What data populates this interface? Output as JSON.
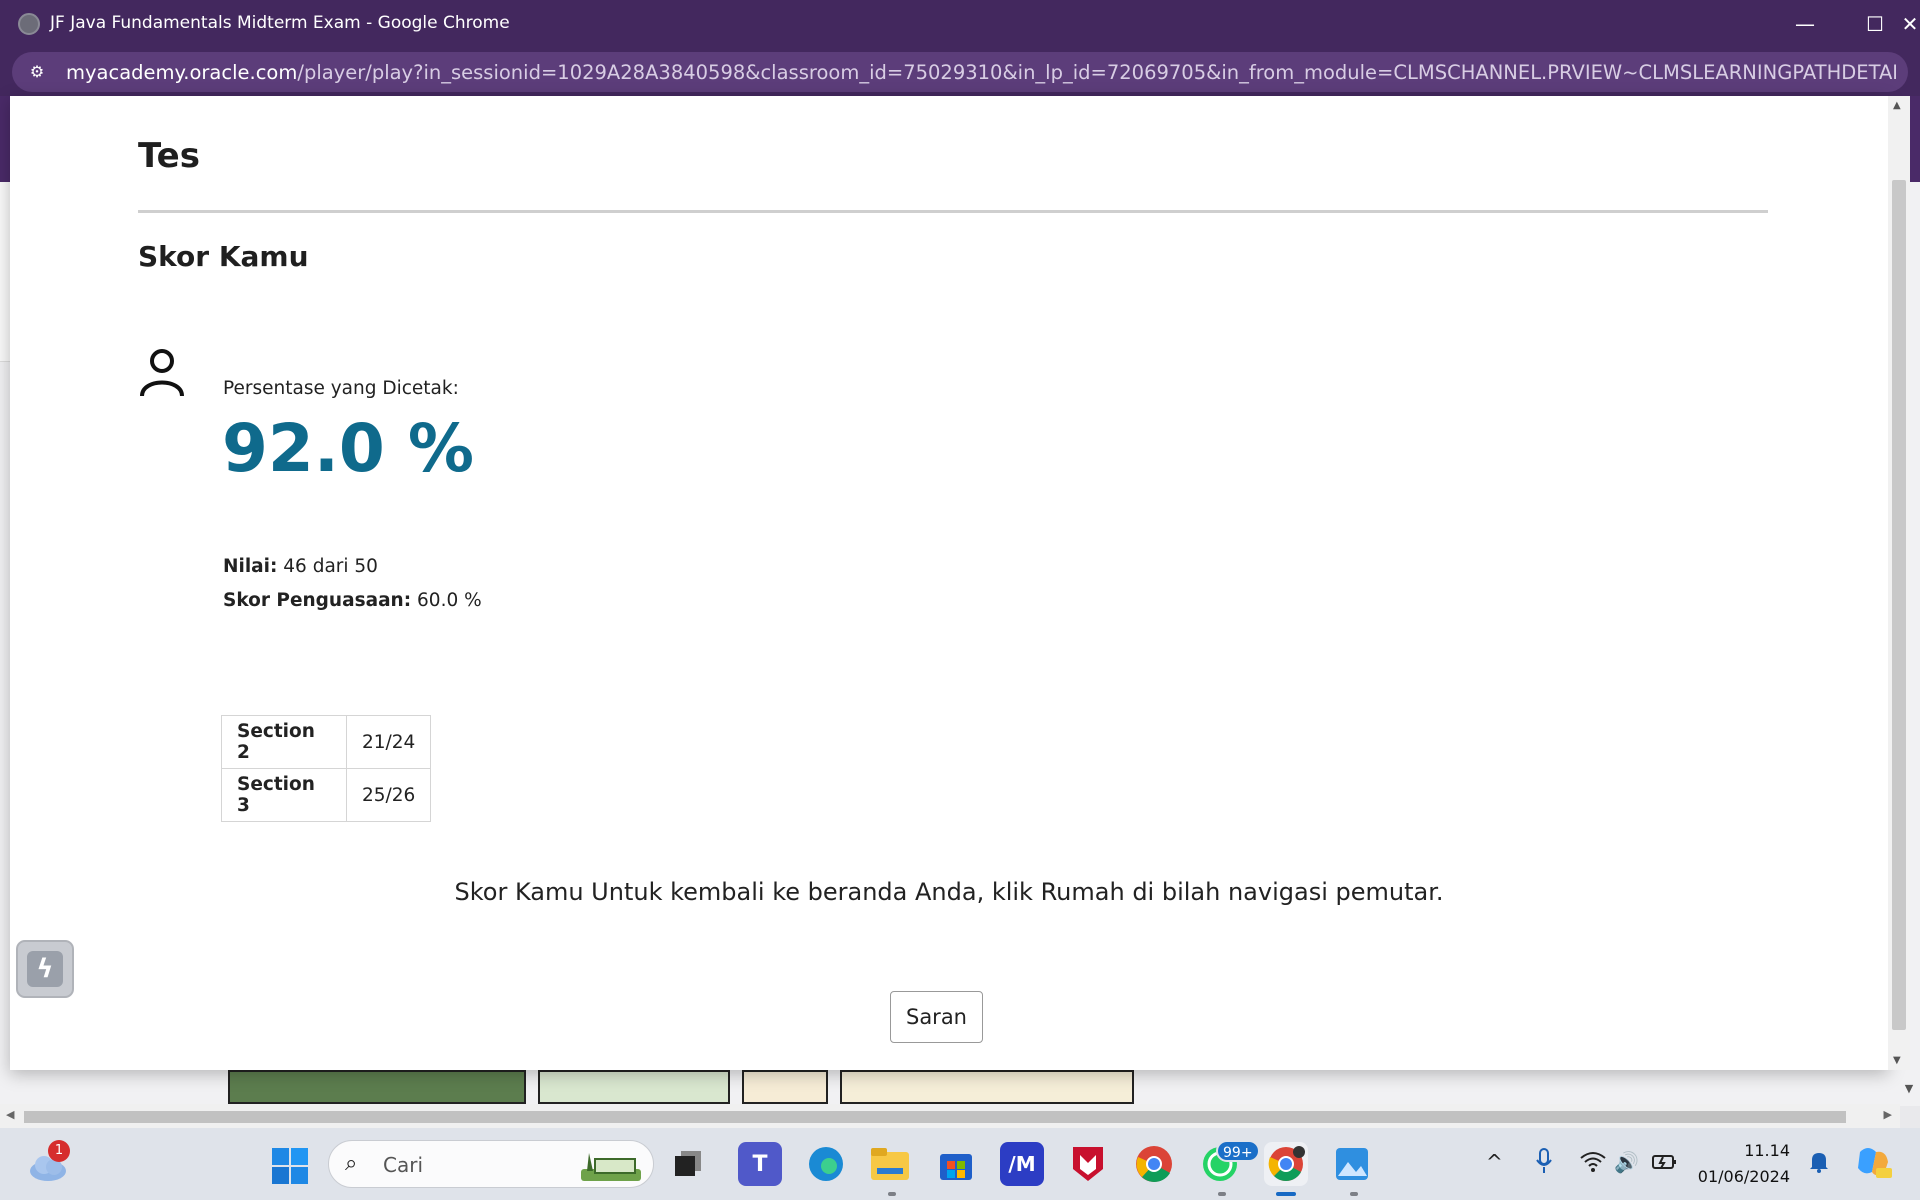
{
  "window": {
    "title": "JF Java Fundamentals Midterm Exam - Google Chrome",
    "minimize": "—",
    "maximize": "☐",
    "close": "✕"
  },
  "address": {
    "host": "myacademy.oracle.com",
    "path": "/player/play?in_sessionid=1029A28A3840598&classroom_id=75029310&in_lp_id=72069705&in_from_module=CLMSCHANNEL.PRVIEW~CLMSLEARNINGPATHDETAILS.PR..."
  },
  "page": {
    "heading": "Tes",
    "score_heading": "Skor Kamu",
    "percentage_label": "Persentase yang Dicetak:",
    "percentage_value": "92.0 %",
    "grade_label": "Nilai:",
    "grade_value": "46 dari 50",
    "mastery_label": "Skor Penguasaan:",
    "mastery_value": "60.0 %",
    "sections": [
      {
        "name": "Section 2",
        "score": "21/24"
      },
      {
        "name": "Section 3",
        "score": "25/26"
      }
    ],
    "message": "Skor Kamu Untuk kembali ke beranda Anda, klik Rumah di bilah navigasi pemutar.",
    "feedback_button": "Saran"
  },
  "taskbar": {
    "weather_badge": "1",
    "search_placeholder": "Cari",
    "whatsapp_badge": "99+",
    "time": "11.14",
    "date": "01/06/2024"
  },
  "colors": {
    "titlebar": "#43285e",
    "score_accent": "#0f6a8c"
  }
}
